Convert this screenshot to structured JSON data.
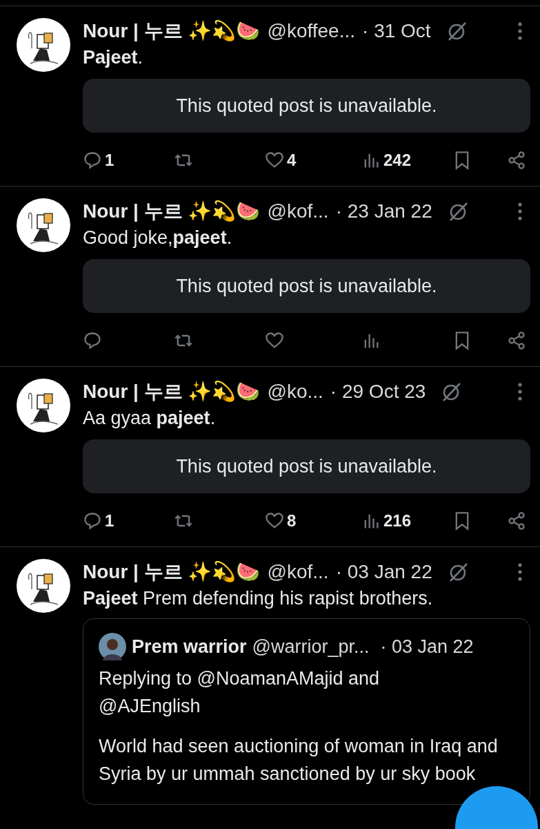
{
  "posts": [
    {
      "author": "Nour | 누르 ✨💫🍉",
      "handle": "@koffee...",
      "date": "· 31 Oct",
      "text": "**Pajeet**.",
      "quote": {
        "kind": "unavailable",
        "text": "This quoted post is unavailable."
      },
      "replies": "1",
      "likes": "4",
      "views": "242"
    },
    {
      "author": "Nour | 누르 ✨💫🍉",
      "handle": "@kof...",
      "date": "· 23 Jan 22",
      "text": "Good joke,**pajeet**.",
      "quote": {
        "kind": "unavailable",
        "text": "This quoted post is unavailable."
      }
    },
    {
      "author": "Nour | 누르 ✨💫🍉",
      "handle": "@ko...",
      "date": "· 29 Oct 23",
      "text": "Aa gyaa **pajeet**.",
      "quote": {
        "kind": "unavailable",
        "text": "This quoted post is unavailable."
      },
      "replies": "1",
      "likes": "8",
      "views": "216"
    },
    {
      "author": "Nour | 누르 ✨💫🍉",
      "handle": "@kof...",
      "date": "· 03 Jan 22",
      "text": "**Pajeet**  Prem defending his rapist brothers.",
      "quote": {
        "kind": "post",
        "author": "Prem warrior",
        "handle": "@warrior_pr...",
        "date": "· 03 Jan 22",
        "reply_line": "Replying to @NoamanAMajid and @AJEnglish",
        "text": "World had seen auctioning of woman in Iraq and Syria by ur ummah sanctioned by ur sky book"
      }
    }
  ]
}
